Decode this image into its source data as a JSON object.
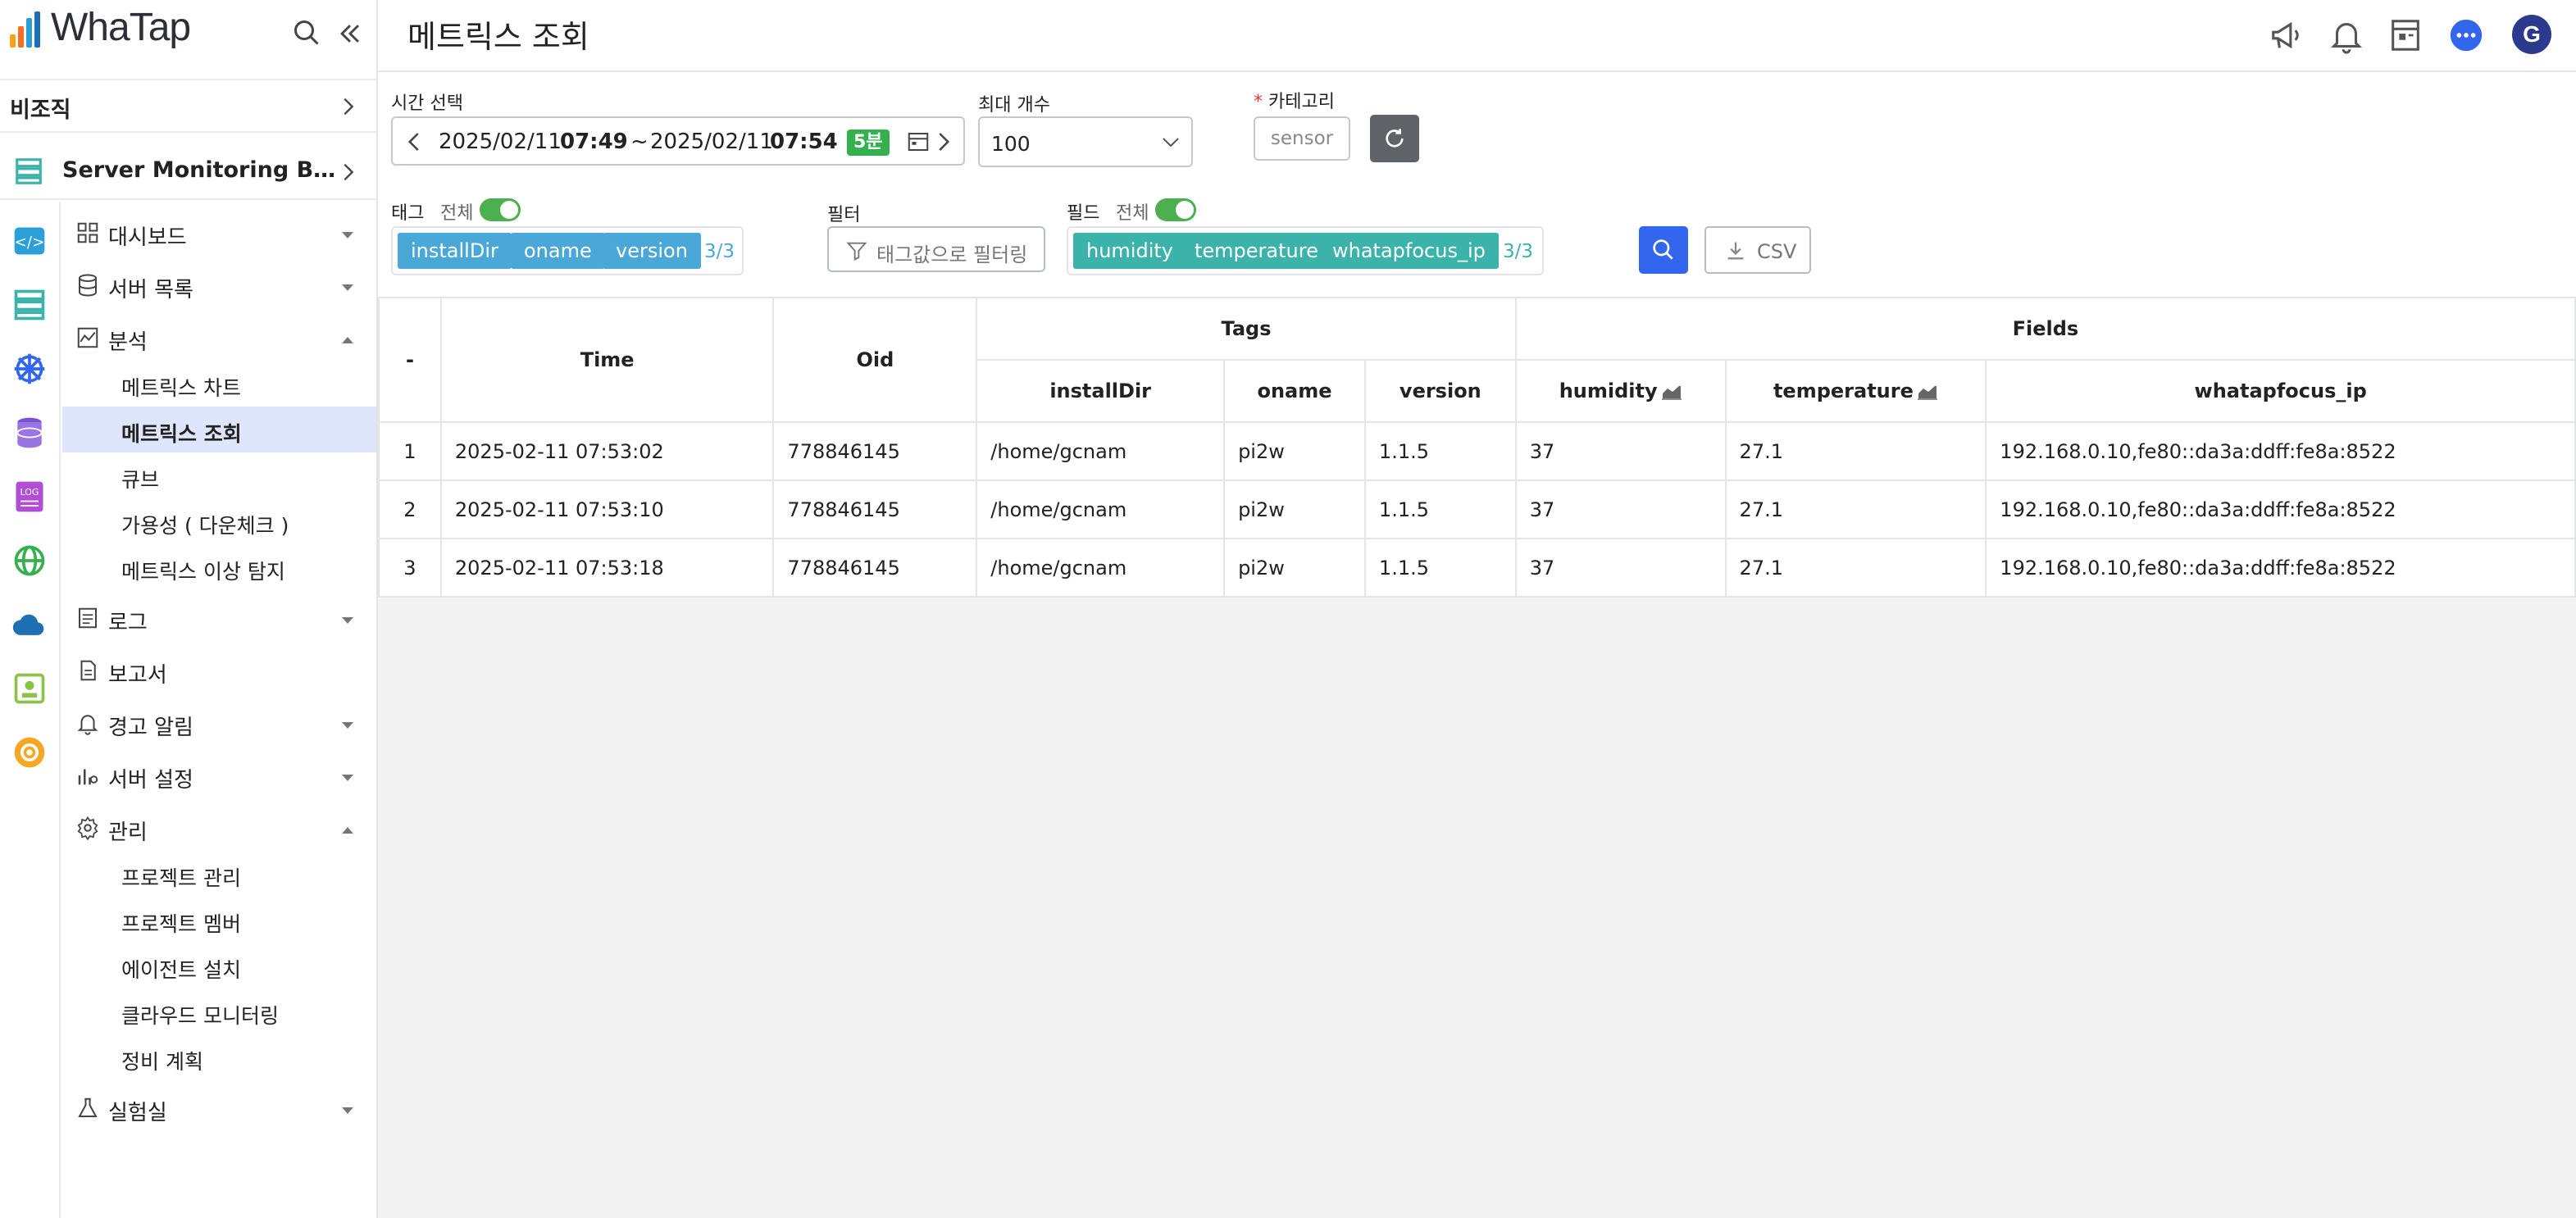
{
  "app": {
    "name": "WhaTap"
  },
  "sidebar": {
    "org_label": "비조직",
    "project_label": "Server Monitoring By Gic...",
    "menu": [
      {
        "label": "대시보드",
        "expanded": false
      },
      {
        "label": "서버 목록",
        "expanded": false
      },
      {
        "label": "분석",
        "expanded": true
      },
      {
        "label": "로그",
        "expanded": false
      },
      {
        "label": "보고서"
      },
      {
        "label": "경고 알림",
        "expanded": false
      },
      {
        "label": "서버 설정",
        "expanded": false
      },
      {
        "label": "관리",
        "expanded": true
      },
      {
        "label": "실험실",
        "expanded": false
      }
    ],
    "analysis_sub": [
      "메트릭스 차트",
      "메트릭스 조회",
      "큐브",
      "가용성 ( 다운체크 )",
      "메트릭스 이상 탐지"
    ],
    "admin_sub": [
      "프로젝트 관리",
      "프로젝트 멤버",
      "에이전트 설치",
      "클라우드 모니터링",
      "정비 계획"
    ]
  },
  "header": {
    "title": "메트릭스 조회",
    "avatar_letter": "G"
  },
  "controls": {
    "time_label": "시간 선택",
    "time_from_date": "2025/02/11",
    "time_from_time": "07:49",
    "time_sep": "~",
    "time_to_date": "2025/02/11",
    "time_to_time": "07:54",
    "time_badge": "5분",
    "max_label": "최대 개수",
    "max_value": "100",
    "category_req": "*",
    "category_label": "카테고리",
    "category_value": "sensor",
    "tag_label": "태그",
    "tag_all": "전체",
    "tags": [
      "installDir",
      "oname",
      "version"
    ],
    "tag_count": "3/3",
    "filter_label": "필터",
    "filter_placeholder": "태그값으로 필터링",
    "field_label": "필드",
    "field_all": "전체",
    "fields": [
      "humidity",
      "temperature",
      "whatapfocus_ip"
    ],
    "field_count": "3/3",
    "csv_label": "CSV"
  },
  "table": {
    "group_tags": "Tags",
    "group_fields": "Fields",
    "col_index": "-",
    "col_time": "Time",
    "col_oid": "Oid",
    "tag_cols": [
      "installDir",
      "oname",
      "version"
    ],
    "field_cols": [
      "humidity",
      "temperature",
      "whatapfocus_ip"
    ],
    "rows": [
      {
        "idx": "1",
        "time": "2025-02-11 07:53:02",
        "oid": "778846145",
        "installDir": "/home/gcnam",
        "oname": "pi2w",
        "version": "1.1.5",
        "humidity": "37",
        "temperature": "27.1",
        "ip": "192.168.0.10,fe80::da3a:ddff:fe8a:8522"
      },
      {
        "idx": "2",
        "time": "2025-02-11 07:53:10",
        "oid": "778846145",
        "installDir": "/home/gcnam",
        "oname": "pi2w",
        "version": "1.1.5",
        "humidity": "37",
        "temperature": "27.1",
        "ip": "192.168.0.10,fe80::da3a:ddff:fe8a:8522"
      },
      {
        "idx": "3",
        "time": "2025-02-11 07:53:18",
        "oid": "778846145",
        "installDir": "/home/gcnam",
        "oname": "pi2w",
        "version": "1.1.5",
        "humidity": "37",
        "temperature": "27.1",
        "ip": "192.168.0.10,fe80::da3a:ddff:fe8a:8522"
      }
    ]
  },
  "colors": {
    "accent": "#3366ee",
    "active_bg": "#dde6fb",
    "tag_chip": "#4aa8d8",
    "field_chip": "#3bb3aa",
    "toggle_on": "#4caf50",
    "badge": "#35b04f"
  }
}
